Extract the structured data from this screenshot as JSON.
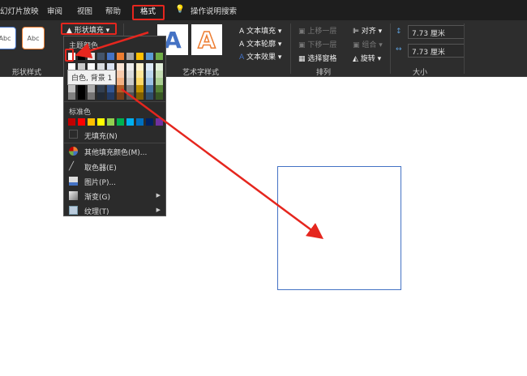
{
  "tabs": [
    "幻灯片放映",
    "审阅",
    "视图",
    "帮助",
    "格式"
  ],
  "search": "操作说明搜索",
  "ribbon": {
    "shape_styles": {
      "label": "形状样式",
      "sample": "Abc"
    },
    "shape_fill": "形状填充",
    "wordart": {
      "label": "艺术字样式",
      "sample": "A",
      "text_fill": "文本填充",
      "text_outline": "文本轮廓",
      "text_effects": "文本效果"
    },
    "arrange": {
      "label": "排列",
      "bring_forward": "上移一层",
      "send_backward": "下移一层",
      "selection_pane": "选择窗格",
      "align": "对齐",
      "group": "组合",
      "rotate": "旋转"
    },
    "size": {
      "label": "大小",
      "height": "7.73 厘米",
      "width": "7.73 厘米"
    }
  },
  "menu": {
    "theme_colors": "主题颜色",
    "standard_colors": "标准色",
    "no_fill": "无填充(N)",
    "more_colors": "其他填充颜色(M)...",
    "eyedropper": "取色器(E)",
    "picture": "图片(P)...",
    "gradient": "渐变(G)",
    "texture": "纹理(T)",
    "tooltip": "白色, 背景 1",
    "theme_top": [
      "#ffffff",
      "#000000",
      "#e7e6e6",
      "#44546a",
      "#4472c4",
      "#ed7d31",
      "#a5a5a5",
      "#ffc000",
      "#5b9bd5",
      "#70ad47"
    ],
    "standard": [
      "#c00000",
      "#ff0000",
      "#ffc000",
      "#ffff00",
      "#92d050",
      "#00b050",
      "#00b0f0",
      "#0070c0",
      "#002060",
      "#7030a0"
    ]
  },
  "accent": "#e5261e"
}
